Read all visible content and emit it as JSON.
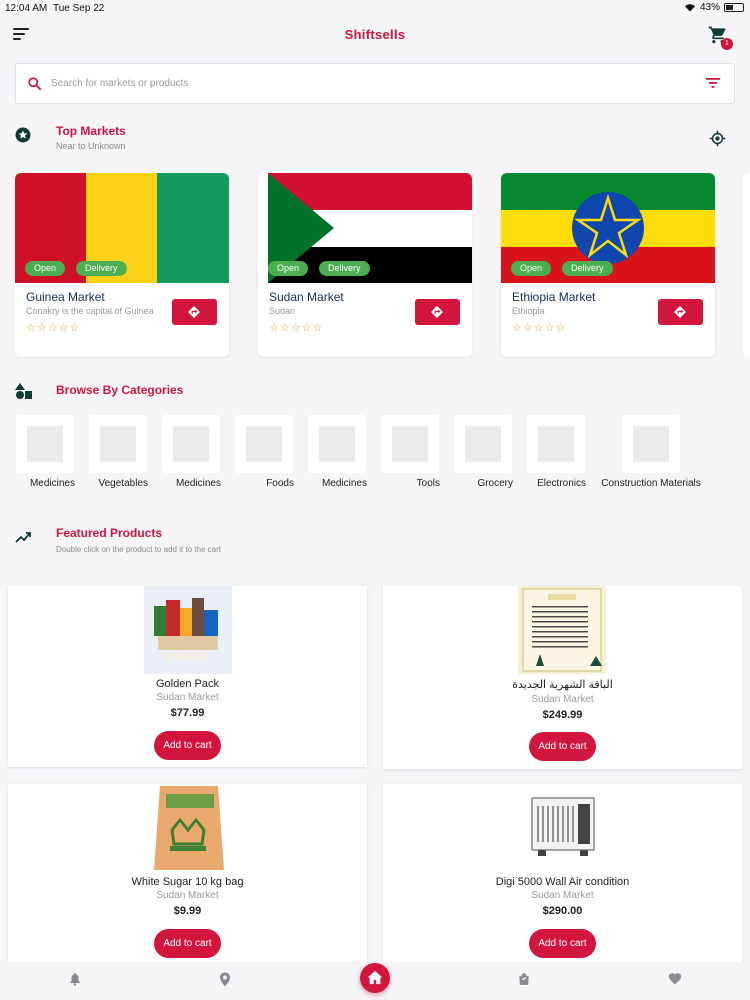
{
  "status": {
    "time": "12:04 AM",
    "date": "Tue Sep 22",
    "battery": "43%"
  },
  "app": {
    "title": "Shiftsells",
    "cart_count": "1"
  },
  "search": {
    "placeholder": "Search for markets or products"
  },
  "top_markets": {
    "title": "Top Markets",
    "subtitle": "Near to Unknown",
    "open_label": "Open",
    "delivery_label": "Delivery",
    "rating": "☆☆☆☆☆",
    "items": [
      {
        "name": "Guinea Market",
        "desc": "Conakry is the capital of Guinea",
        "flag": "guinea"
      },
      {
        "name": "Sudan Market",
        "desc": "Sudan",
        "flag": "sudan"
      },
      {
        "name": "Ethiopia Market",
        "desc": "Ethiopia",
        "flag": "ethiopia"
      }
    ]
  },
  "categories": {
    "title": "Browse By Categories",
    "items": [
      "Medicines",
      "Vegetables",
      "Medicines",
      "Foods",
      "Medicines",
      "Tools",
      "Grocery",
      "Electronics",
      "Construction Materials"
    ]
  },
  "featured": {
    "title": "Featured Products",
    "subtitle": "Double click on the product to add it to the cart",
    "add_label": "Add to cart",
    "items": [
      {
        "name": "Golden Pack",
        "market": "Sudan Market",
        "price": "$77.99"
      },
      {
        "name": "الباقة الشهرية الجديدة",
        "market": "Sudan Market",
        "price": "$249.99"
      },
      {
        "name": "White Sugar 10 kg bag",
        "market": "Sudan Market",
        "price": "$9.99"
      },
      {
        "name": "Digi 5000 Wall Air condition",
        "market": "Sudan Market",
        "price": "$290.00"
      }
    ]
  },
  "colors": {
    "accent": "#d2153d",
    "green": "#4cae50",
    "dark": "#0e3b34"
  },
  "icons": [
    "menu-icon",
    "cart-icon",
    "search-icon",
    "filter-icon",
    "star-badge-icon",
    "location-target-icon",
    "directions-icon",
    "shapes-icon",
    "trending-icon",
    "bell-icon",
    "map-pin-icon",
    "home-icon",
    "bag-icon",
    "heart-icon"
  ]
}
